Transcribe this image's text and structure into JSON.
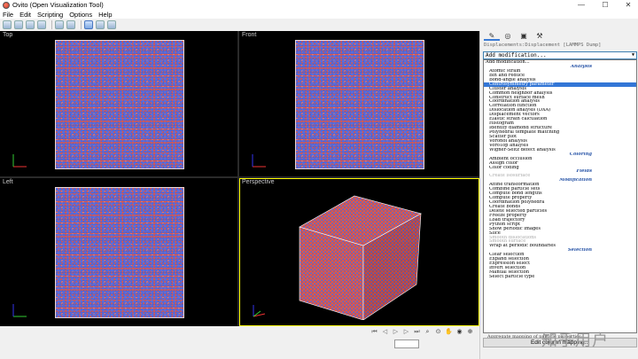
{
  "window": {
    "title": "Ovito (Open Visualization Tool)",
    "controls": [
      "—",
      "☐",
      "✕"
    ]
  },
  "menu": [
    "File",
    "Edit",
    "Scripting",
    "Options",
    "Help"
  ],
  "viewports": [
    {
      "caption": "Top"
    },
    {
      "caption": "Front"
    },
    {
      "caption": "Left"
    },
    {
      "caption": "Perspective"
    }
  ],
  "pipeline": {
    "header": "Displacements:Displacement [LAMMPS Dump]",
    "combo_value": "Add modification...",
    "below_text": "Aggregate mapping of particle properties:",
    "edit_button": "Edit column mapping..."
  },
  "dropdown": [
    {
      "t": "Add modification...",
      "k": "plain"
    },
    {
      "t": "Analysis",
      "k": "grp"
    },
    {
      "t": "Atomic strain"
    },
    {
      "t": "Bin and reduce"
    },
    {
      "t": "Bond-angle analysis"
    },
    {
      "t": "Centrosymmetry parameter",
      "k": "hl"
    },
    {
      "t": "Cluster analysis"
    },
    {
      "t": "Common neighbor analysis"
    },
    {
      "t": "Construct surface mesh"
    },
    {
      "t": "Coordination analysis"
    },
    {
      "t": "Correlation function"
    },
    {
      "t": "Dislocation analysis (DXA)"
    },
    {
      "t": "Displacement vectors"
    },
    {
      "t": "Elastic strain calculation"
    },
    {
      "t": "Histogram"
    },
    {
      "t": "Identify diamond structure"
    },
    {
      "t": "Polyhedral template matching"
    },
    {
      "t": "Scatter plot"
    },
    {
      "t": "Voronoi analysis"
    },
    {
      "t": "VoroTop analysis"
    },
    {
      "t": "Wigner-Seitz defect analysis"
    },
    {
      "t": "Coloring",
      "k": "grp"
    },
    {
      "t": "Ambient occlusion"
    },
    {
      "t": "Assign color"
    },
    {
      "t": "Color coding"
    },
    {
      "t": "Fields",
      "k": "grp"
    },
    {
      "t": "Create isosurface",
      "k": "dis"
    },
    {
      "t": "Modification",
      "k": "grp"
    },
    {
      "t": "Affine transformation"
    },
    {
      "t": "Combine particle sets"
    },
    {
      "t": "Compute bond lengths"
    },
    {
      "t": "Compute property"
    },
    {
      "t": "Coordination polyhedra"
    },
    {
      "t": "Create bonds"
    },
    {
      "t": "Delete selected particles"
    },
    {
      "t": "Freeze property"
    },
    {
      "t": "Load trajectory"
    },
    {
      "t": "Python script"
    },
    {
      "t": "Show periodic images"
    },
    {
      "t": "Slice"
    },
    {
      "t": "Smooth dislocations",
      "k": "dis"
    },
    {
      "t": "Smooth surface",
      "k": "dis"
    },
    {
      "t": "Wrap at periodic boundaries"
    },
    {
      "t": "Selection",
      "k": "grp"
    },
    {
      "t": "Clear selection"
    },
    {
      "t": "Expand selection"
    },
    {
      "t": "Expression select"
    },
    {
      "t": "Invert selection"
    },
    {
      "t": "Manual selection"
    },
    {
      "t": "Select particle type"
    }
  ],
  "watermark": "知乎用户",
  "colors": {
    "selected": "#3376d6",
    "active_viewport": "#ffff00",
    "particle_a": "#e05848",
    "particle_b": "#5468d8"
  }
}
